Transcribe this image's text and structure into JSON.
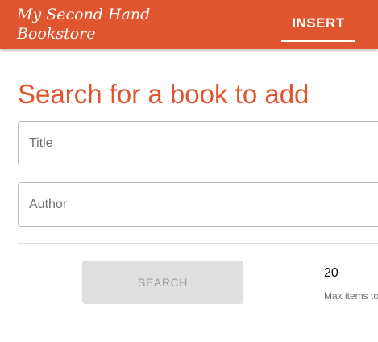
{
  "header": {
    "brand_line1": "My Second Hand",
    "brand_line2": "Bookstore",
    "nav_insert": "INSERT"
  },
  "main": {
    "title": "Search for a book to add",
    "title_field": {
      "placeholder": "Title",
      "value": ""
    },
    "author_field": {
      "placeholder": "Author",
      "value": ""
    },
    "search_button": "SEARCH",
    "max_items": {
      "value": "20",
      "helper": "Max items to"
    }
  },
  "colors": {
    "primary": "#df5530",
    "disabled_button_bg": "#e0e0e0",
    "disabled_button_text": "#9e9e9e"
  }
}
